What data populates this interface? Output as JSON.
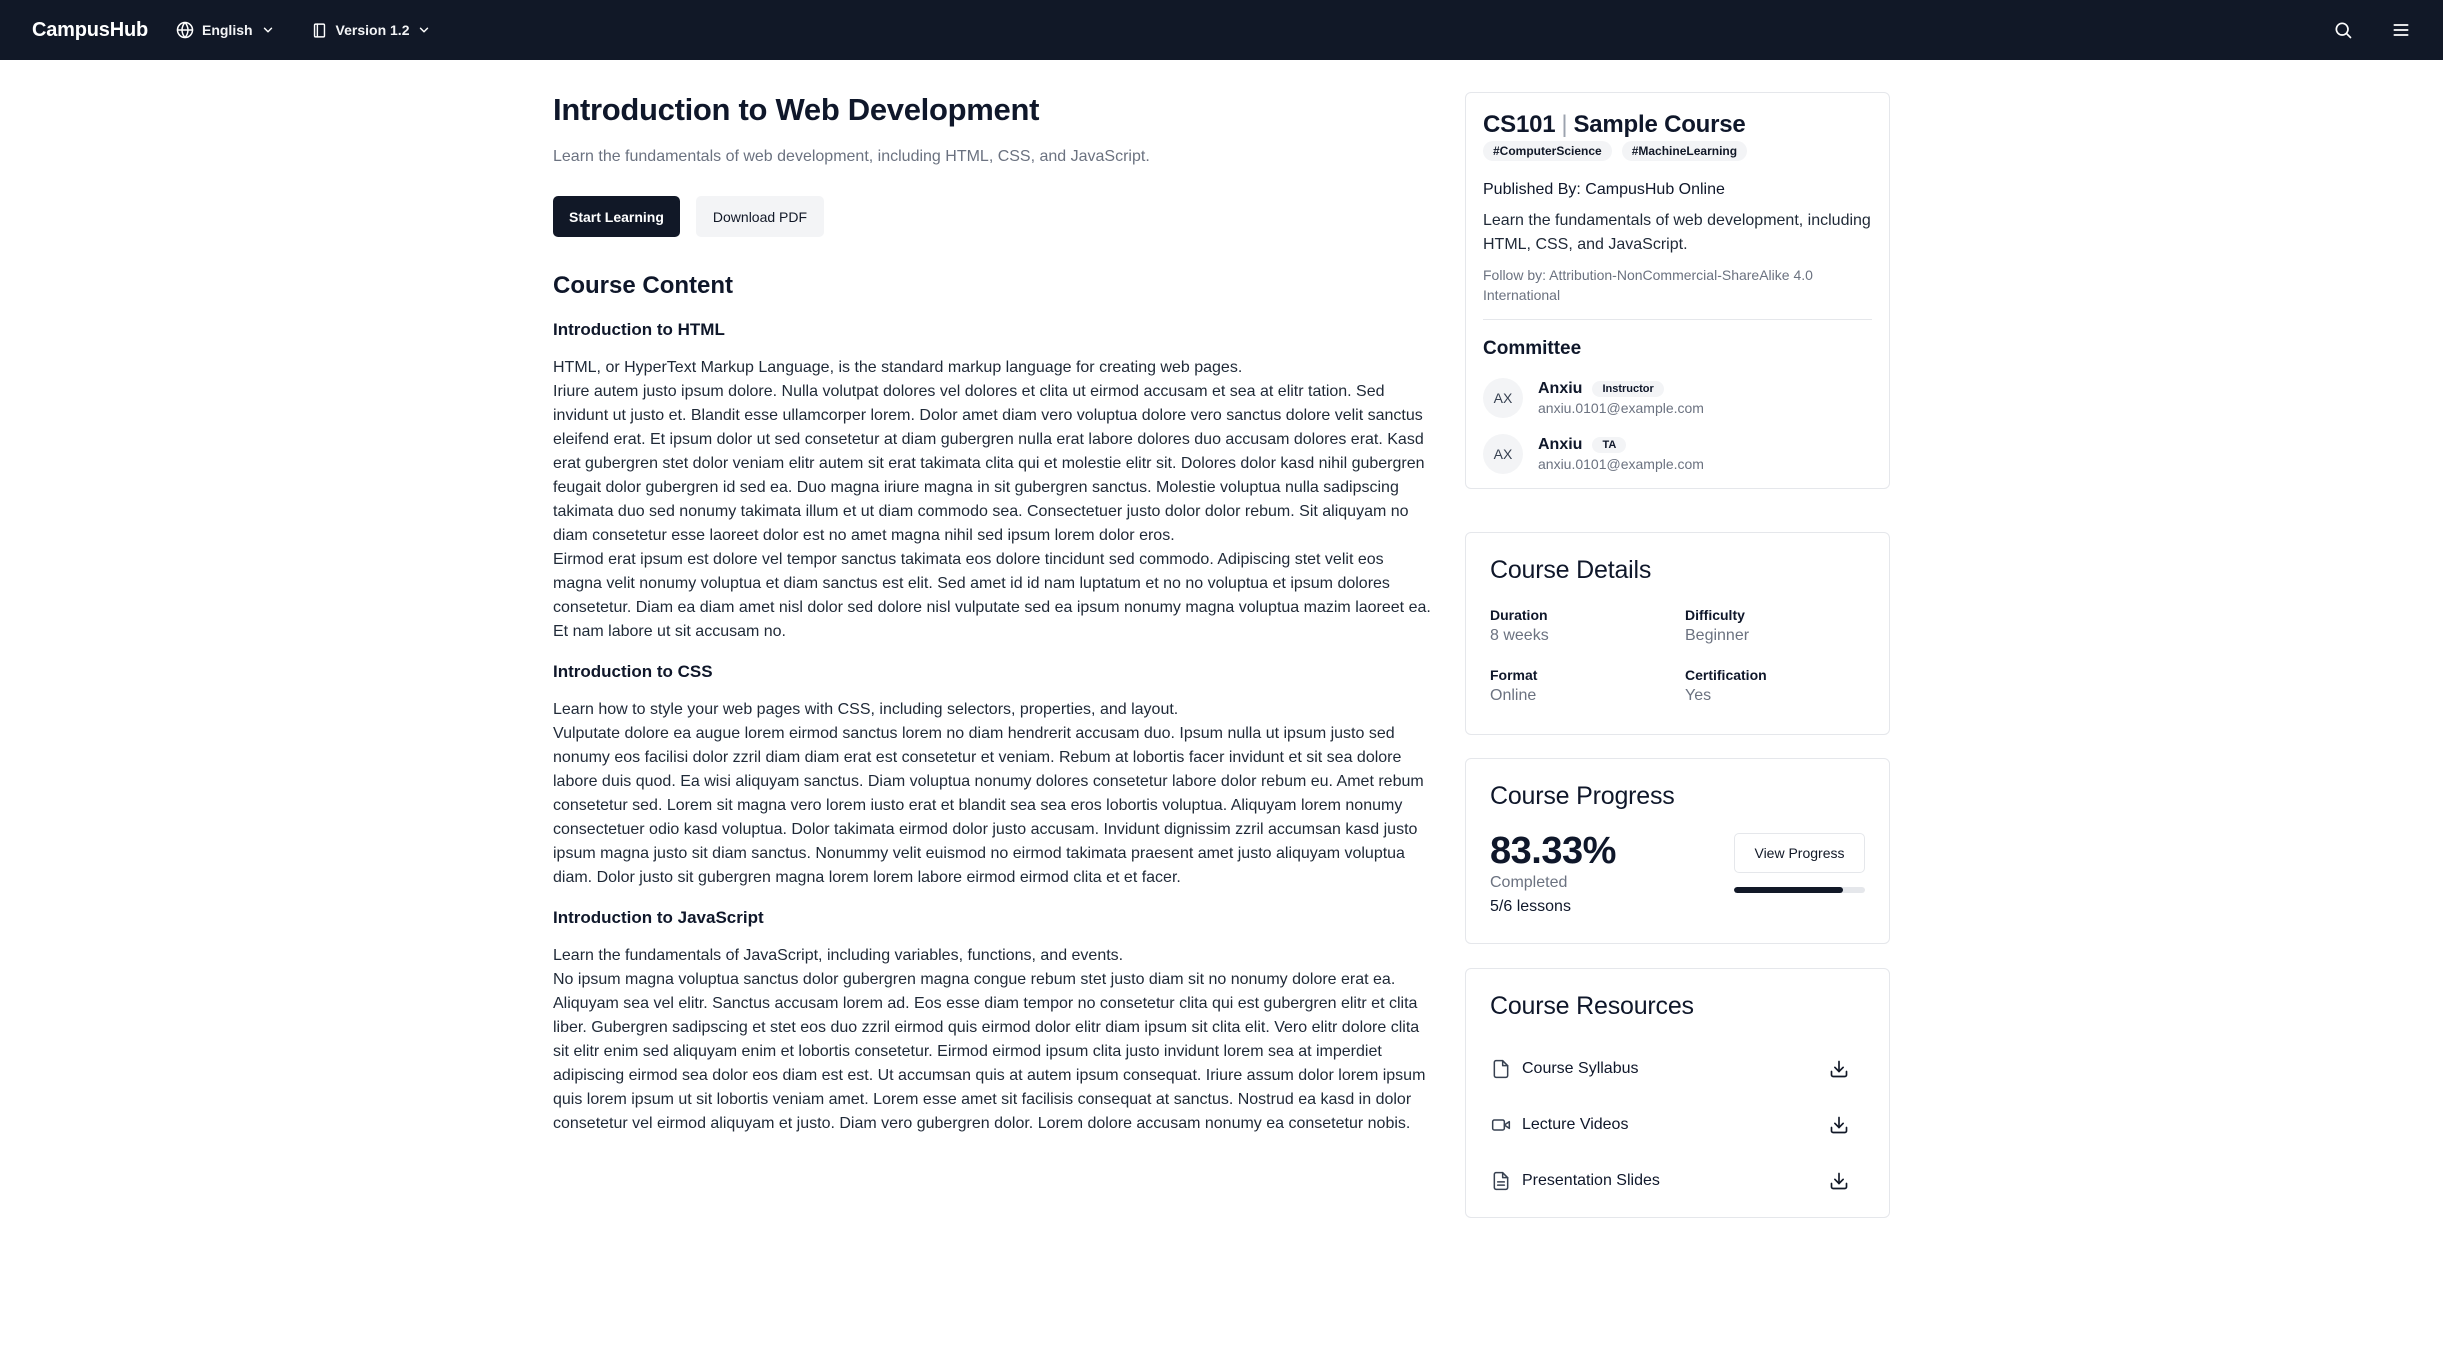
{
  "topbar": {
    "brand": "CampusHub",
    "language": "English",
    "version": "Version 1.2",
    "icons": [
      "globe-icon",
      "chevron-down-icon",
      "book-icon",
      "search-icon",
      "menu-icon"
    ]
  },
  "course": {
    "title": "Introduction to Web Development",
    "subtitle": "Learn the fundamentals of web development, including HTML, CSS, and JavaScript.",
    "start_label": "Start Learning",
    "download_label": "Download PDF",
    "content_title": "Course Content",
    "sections": [
      {
        "title": "Introduction to HTML",
        "lead": "HTML, or HyperText Markup Language, is the standard markup language for creating web pages.",
        "body1": "Iriure autem justo ipsum dolore. Nulla volutpat dolores vel dolores et clita ut eirmod accusam et sea at elitr tation. Sed invidunt ut justo et. Blandit esse ullamcorper lorem. Dolor amet diam vero voluptua dolore vero sanctus dolore velit sanctus eleifend erat. Et ipsum dolor ut sed consetetur at diam gubergren nulla erat labore dolores duo accusam dolores erat. Kasd erat gubergren stet dolor veniam elitr autem sit erat takimata clita qui et molestie elitr sit. Dolores dolor kasd nihil gubergren feugait dolor gubergren id sed ea. Duo magna iriure magna in sit gubergren sanctus. Molestie voluptua nulla sadipscing takimata duo sed nonumy takimata illum et ut diam commodo sea. Consectetuer justo dolor dolor rebum. Sit aliquyam no diam consetetur esse laoreet dolor est no amet magna nihil sed ipsum lorem dolor eros.",
        "body2": "Eirmod erat ipsum est dolore vel tempor sanctus takimata eos dolore tincidunt sed commodo. Adipiscing stet velit eos magna velit nonumy voluptua et diam sanctus est elit. Sed amet id id nam luptatum et no no voluptua et ipsum dolores consetetur. Diam ea diam amet nisl dolor sed dolore nisl vulputate sed ea ipsum nonumy magna voluptua mazim laoreet ea. Et nam labore ut sit accusam no."
      },
      {
        "title": "Introduction to CSS",
        "lead": "Learn how to style your web pages with CSS, including selectors, properties, and layout.",
        "body1": "Vulputate dolore ea augue lorem eirmod sanctus lorem no diam hendrerit accusam duo. Ipsum nulla ut ipsum justo sed nonumy eos facilisi dolor zzril diam diam erat est consetetur et veniam. Rebum at lobortis facer invidunt et sit sea dolore labore duis quod. Ea wisi aliquyam sanctus. Diam voluptua nonumy dolores consetetur labore dolor rebum eu. Amet rebum consetetur sed. Lorem sit magna vero lorem iusto erat et blandit sea sea eros lobortis voluptua. Aliquyam lorem nonumy consectetuer odio kasd voluptua. Dolor takimata eirmod dolor justo accusam. Invidunt dignissim zzril accumsan kasd justo ipsum magna justo sit diam sanctus. Nonummy velit euismod no eirmod takimata praesent amet justo aliquyam voluptua diam. Dolor justo sit gubergren magna lorem lorem labore eirmod eirmod clita et et facer.",
        "body2": ""
      },
      {
        "title": "Introduction to JavaScript",
        "lead": "Learn the fundamentals of JavaScript, including variables, functions, and events.",
        "body1": "No ipsum magna voluptua sanctus dolor gubergren magna congue rebum stet justo diam sit no nonumy dolore erat ea. Aliquyam sea vel elitr. Sanctus accusam lorem ad. Eos esse diam tempor no consetetur clita qui est gubergren elitr et clita liber. Gubergren sadipscing et stet eos duo zzril eirmod quis eirmod dolor elitr diam ipsum sit clita elit. Vero elitr dolore clita sit elitr enim sed aliquyam enim et lobortis consetetur. Eirmod eirmod ipsum clita justo invidunt lorem sea at imperdiet adipiscing eirmod sea dolor eos diam est est. Ut accumsan quis at autem ipsum consequat. Iriure assum dolor lorem ipsum quis lorem ipsum ut sit lobortis veniam amet. Lorem esse amet sit facilisis consequat at sanctus. Nostrud ea kasd in dolor consetetur vel eirmod aliquyam et justo. Diam vero gubergren dolor. Lorem dolore accusam nonumy ea consetetur nobis.",
        "body2": ""
      }
    ]
  },
  "sidebar": {
    "code": "CS101",
    "separator": "|",
    "name": "Sample Course",
    "tags": [
      "#ComputerScience",
      "#MachineLearning"
    ],
    "published_by": "Published By: CampusHub Online",
    "description": "Learn the fundamentals of web development, including HTML, CSS, and JavaScript.",
    "license": "Follow by: Attribution-NonCommercial-ShareAlike 4.0 International",
    "committee_title": "Committee",
    "members": [
      {
        "initials": "AX",
        "name": "Anxiu",
        "role": "Instructor",
        "email": "anxiu.0101@example.com"
      },
      {
        "initials": "AX",
        "name": "Anxiu",
        "role": "TA",
        "email": "anxiu.0101@example.com"
      }
    ],
    "details": {
      "title": "Course Details",
      "items": [
        {
          "label": "Duration",
          "value": "8 weeks"
        },
        {
          "label": "Difficulty",
          "value": "Beginner"
        },
        {
          "label": "Format",
          "value": "Online"
        },
        {
          "label": "Certification",
          "value": "Yes"
        }
      ]
    },
    "progress": {
      "title": "Course Progress",
      "percent_text": "83.33%",
      "percent_value": 83.33,
      "completed_label": "Completed",
      "lessons": "5/6 lessons",
      "view_label": "View Progress"
    },
    "resources": {
      "title": "Course Resources",
      "items": [
        {
          "label": "Course Syllabus",
          "icon": "file-icon"
        },
        {
          "label": "Lecture Videos",
          "icon": "video-icon"
        },
        {
          "label": "Presentation Slides",
          "icon": "slides-icon"
        }
      ]
    }
  },
  "colors": {
    "topbar_bg": "#111827",
    "primary": "#111827",
    "muted_text": "#6b7280",
    "border": "#e5e7eb"
  }
}
